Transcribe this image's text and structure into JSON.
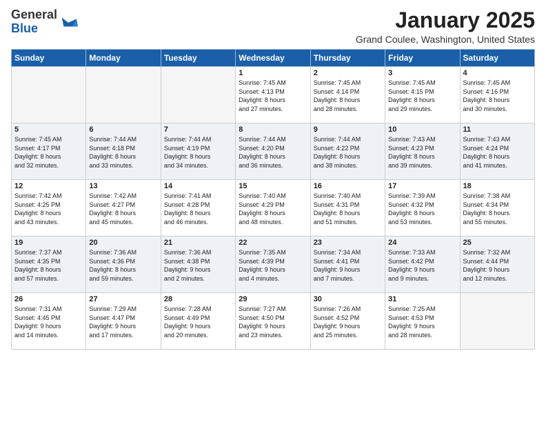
{
  "logo": {
    "general": "General",
    "blue": "Blue"
  },
  "title": "January 2025",
  "location": "Grand Coulee, Washington, United States",
  "days_of_week": [
    "Sunday",
    "Monday",
    "Tuesday",
    "Wednesday",
    "Thursday",
    "Friday",
    "Saturday"
  ],
  "weeks": [
    {
      "shaded": false,
      "days": [
        {
          "num": "",
          "info": "",
          "empty": true
        },
        {
          "num": "",
          "info": "",
          "empty": true
        },
        {
          "num": "",
          "info": "",
          "empty": true
        },
        {
          "num": "1",
          "info": "Sunrise: 7:45 AM\nSunset: 4:13 PM\nDaylight: 8 hours\nand 27 minutes.",
          "empty": false
        },
        {
          "num": "2",
          "info": "Sunrise: 7:45 AM\nSunset: 4:14 PM\nDaylight: 8 hours\nand 28 minutes.",
          "empty": false
        },
        {
          "num": "3",
          "info": "Sunrise: 7:45 AM\nSunset: 4:15 PM\nDaylight: 8 hours\nand 29 minutes.",
          "empty": false
        },
        {
          "num": "4",
          "info": "Sunrise: 7:45 AM\nSunset: 4:16 PM\nDaylight: 8 hours\nand 30 minutes.",
          "empty": false
        }
      ]
    },
    {
      "shaded": true,
      "days": [
        {
          "num": "5",
          "info": "Sunrise: 7:45 AM\nSunset: 4:17 PM\nDaylight: 8 hours\nand 32 minutes.",
          "empty": false
        },
        {
          "num": "6",
          "info": "Sunrise: 7:44 AM\nSunset: 4:18 PM\nDaylight: 8 hours\nand 33 minutes.",
          "empty": false
        },
        {
          "num": "7",
          "info": "Sunrise: 7:44 AM\nSunset: 4:19 PM\nDaylight: 8 hours\nand 34 minutes.",
          "empty": false
        },
        {
          "num": "8",
          "info": "Sunrise: 7:44 AM\nSunset: 4:20 PM\nDaylight: 8 hours\nand 36 minutes.",
          "empty": false
        },
        {
          "num": "9",
          "info": "Sunrise: 7:44 AM\nSunset: 4:22 PM\nDaylight: 8 hours\nand 38 minutes.",
          "empty": false
        },
        {
          "num": "10",
          "info": "Sunrise: 7:43 AM\nSunset: 4:23 PM\nDaylight: 8 hours\nand 39 minutes.",
          "empty": false
        },
        {
          "num": "11",
          "info": "Sunrise: 7:43 AM\nSunset: 4:24 PM\nDaylight: 8 hours\nand 41 minutes.",
          "empty": false
        }
      ]
    },
    {
      "shaded": false,
      "days": [
        {
          "num": "12",
          "info": "Sunrise: 7:42 AM\nSunset: 4:25 PM\nDaylight: 8 hours\nand 43 minutes.",
          "empty": false
        },
        {
          "num": "13",
          "info": "Sunrise: 7:42 AM\nSunset: 4:27 PM\nDaylight: 8 hours\nand 45 minutes.",
          "empty": false
        },
        {
          "num": "14",
          "info": "Sunrise: 7:41 AM\nSunset: 4:28 PM\nDaylight: 8 hours\nand 46 minutes.",
          "empty": false
        },
        {
          "num": "15",
          "info": "Sunrise: 7:40 AM\nSunset: 4:29 PM\nDaylight: 8 hours\nand 48 minutes.",
          "empty": false
        },
        {
          "num": "16",
          "info": "Sunrise: 7:40 AM\nSunset: 4:31 PM\nDaylight: 8 hours\nand 51 minutes.",
          "empty": false
        },
        {
          "num": "17",
          "info": "Sunrise: 7:39 AM\nSunset: 4:32 PM\nDaylight: 8 hours\nand 53 minutes.",
          "empty": false
        },
        {
          "num": "18",
          "info": "Sunrise: 7:38 AM\nSunset: 4:34 PM\nDaylight: 8 hours\nand 55 minutes.",
          "empty": false
        }
      ]
    },
    {
      "shaded": true,
      "days": [
        {
          "num": "19",
          "info": "Sunrise: 7:37 AM\nSunset: 4:35 PM\nDaylight: 8 hours\nand 57 minutes.",
          "empty": false
        },
        {
          "num": "20",
          "info": "Sunrise: 7:36 AM\nSunset: 4:36 PM\nDaylight: 8 hours\nand 59 minutes.",
          "empty": false
        },
        {
          "num": "21",
          "info": "Sunrise: 7:36 AM\nSunset: 4:38 PM\nDaylight: 9 hours\nand 2 minutes.",
          "empty": false
        },
        {
          "num": "22",
          "info": "Sunrise: 7:35 AM\nSunset: 4:39 PM\nDaylight: 9 hours\nand 4 minutes.",
          "empty": false
        },
        {
          "num": "23",
          "info": "Sunrise: 7:34 AM\nSunset: 4:41 PM\nDaylight: 9 hours\nand 7 minutes.",
          "empty": false
        },
        {
          "num": "24",
          "info": "Sunrise: 7:33 AM\nSunset: 4:42 PM\nDaylight: 9 hours\nand 9 minutes.",
          "empty": false
        },
        {
          "num": "25",
          "info": "Sunrise: 7:32 AM\nSunset: 4:44 PM\nDaylight: 9 hours\nand 12 minutes.",
          "empty": false
        }
      ]
    },
    {
      "shaded": false,
      "days": [
        {
          "num": "26",
          "info": "Sunrise: 7:31 AM\nSunset: 4:45 PM\nDaylight: 9 hours\nand 14 minutes.",
          "empty": false
        },
        {
          "num": "27",
          "info": "Sunrise: 7:29 AM\nSunset: 4:47 PM\nDaylight: 9 hours\nand 17 minutes.",
          "empty": false
        },
        {
          "num": "28",
          "info": "Sunrise: 7:28 AM\nSunset: 4:49 PM\nDaylight: 9 hours\nand 20 minutes.",
          "empty": false
        },
        {
          "num": "29",
          "info": "Sunrise: 7:27 AM\nSunset: 4:50 PM\nDaylight: 9 hours\nand 23 minutes.",
          "empty": false
        },
        {
          "num": "30",
          "info": "Sunrise: 7:26 AM\nSunset: 4:52 PM\nDaylight: 9 hours\nand 25 minutes.",
          "empty": false
        },
        {
          "num": "31",
          "info": "Sunrise: 7:25 AM\nSunset: 4:53 PM\nDaylight: 9 hours\nand 28 minutes.",
          "empty": false
        },
        {
          "num": "",
          "info": "",
          "empty": true
        }
      ]
    }
  ]
}
